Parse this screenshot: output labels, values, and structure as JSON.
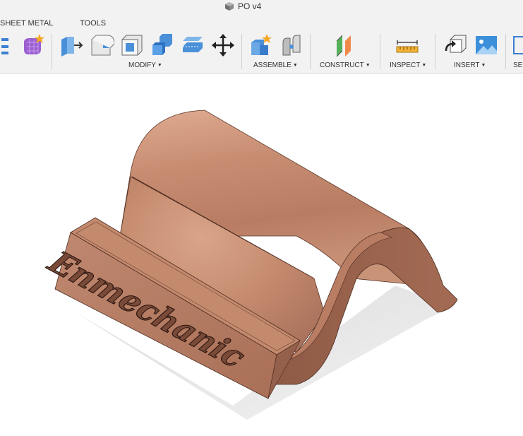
{
  "app": {
    "document_title": "PO v4"
  },
  "tabs": [
    {
      "label": "SHEET METAL"
    },
    {
      "label": "TOOLS"
    }
  ],
  "toolbar": {
    "groups": [
      {
        "label": "MODIFY",
        "has_dropdown": true
      },
      {
        "label": "ASSEMBLE",
        "has_dropdown": true
      },
      {
        "label": "CONSTRUCT",
        "has_dropdown": true
      },
      {
        "label": "INSPECT",
        "has_dropdown": true
      },
      {
        "label": "INSERT",
        "has_dropdown": true
      },
      {
        "label": "SE",
        "has_dropdown": false
      }
    ],
    "icons": [
      "hierarchy-icon",
      "create-form-icon",
      "press-pull-icon",
      "fillet-icon",
      "shell-icon",
      "combine-icon",
      "replace-face-icon",
      "move-icon",
      "new-component-icon",
      "joint-icon",
      "offset-plane-icon",
      "measure-icon",
      "insert-derive-icon",
      "insert-canvas-icon"
    ]
  },
  "viewport": {
    "model_engraving": "Enmechanic",
    "material_color": "#c48a6e",
    "background_color": "#ffffff"
  }
}
